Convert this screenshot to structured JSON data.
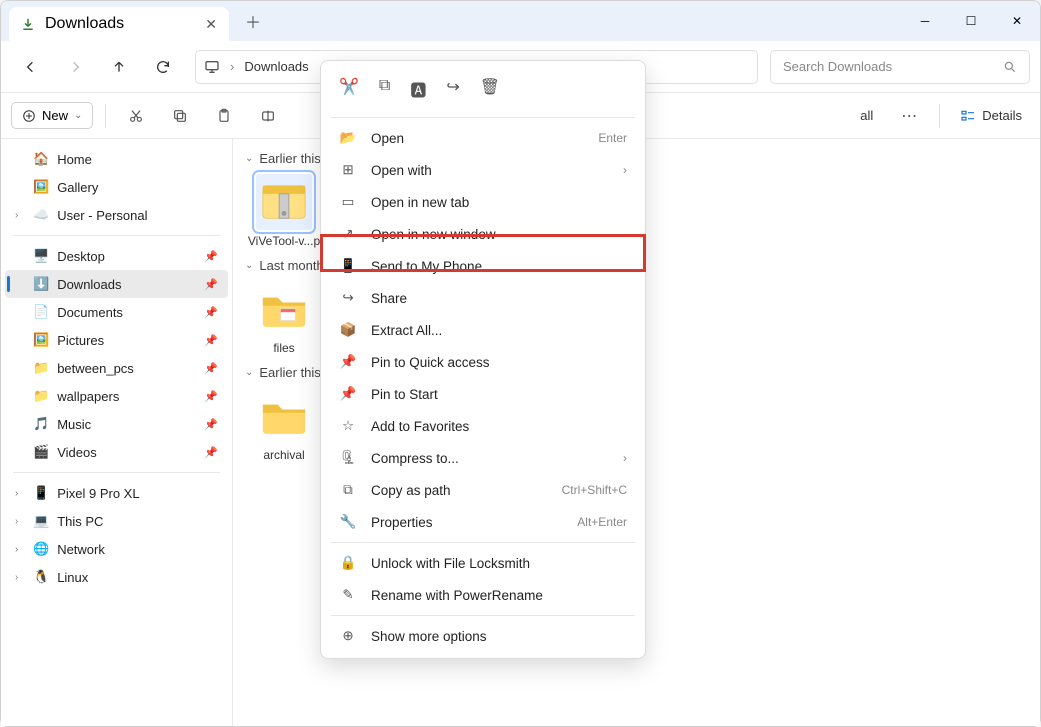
{
  "tab": {
    "title": "Downloads"
  },
  "addr": {
    "crumb": "Downloads"
  },
  "search": {
    "placeholder": "Search Downloads"
  },
  "toolbar": {
    "new": "New",
    "all": "all",
    "details": "Details"
  },
  "sidebar": {
    "home": "Home",
    "gallery": "Gallery",
    "user": "User - Personal",
    "desktop": "Desktop",
    "downloads": "Downloads",
    "documents": "Documents",
    "pictures": "Pictures",
    "between": "between_pcs",
    "wallpapers": "wallpapers",
    "music": "Music",
    "videos": "Videos",
    "pixel": "Pixel 9 Pro XL",
    "thispc": "This PC",
    "network": "Network",
    "linux": "Linux"
  },
  "groups": {
    "g1": "Earlier this week",
    "g2": "Last month",
    "g3": "Earlier this year"
  },
  "files": {
    "f1": "ViVeTool-v...p",
    "f2": "files",
    "f3": "archival"
  },
  "ctx": {
    "open": "Open",
    "open_k": "Enter",
    "openwith": "Open with",
    "newtab": "Open in new tab",
    "newwin": "Open in new window",
    "sendphone": "Send to My Phone",
    "share": "Share",
    "extract": "Extract All...",
    "pinquick": "Pin to Quick access",
    "pinstart": "Pin to Start",
    "favorite": "Add to Favorites",
    "compress": "Compress to...",
    "copypath": "Copy as path",
    "copypath_k": "Ctrl+Shift+C",
    "properties": "Properties",
    "properties_k": "Alt+Enter",
    "unlock": "Unlock with File Locksmith",
    "rename": "Rename with PowerRename",
    "more": "Show more options"
  }
}
